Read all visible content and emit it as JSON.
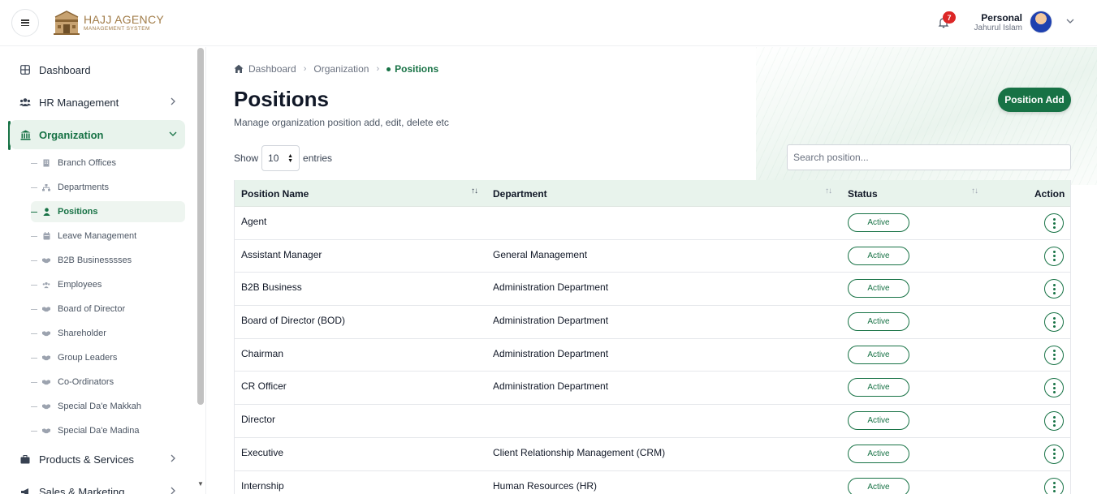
{
  "header": {
    "logo_title": "HAJJ AGENCY",
    "logo_subtitle": "MANAGEMENT SYSTEM",
    "notification_count": "7",
    "user_role": "Personal",
    "user_name": "Jahurul Islam"
  },
  "sidebar": {
    "items": [
      {
        "label": "Dashboard",
        "icon": "grid-icon"
      },
      {
        "label": "HR Management",
        "icon": "users-icon"
      },
      {
        "label": "Organization",
        "icon": "bank-icon",
        "expanded": true
      },
      {
        "label": "Products & Services",
        "icon": "briefcase-icon"
      },
      {
        "label": "Sales & Marketing",
        "icon": "megaphone-icon"
      }
    ],
    "sub_items": [
      {
        "label": "Branch Offices",
        "icon": "building-icon"
      },
      {
        "label": "Departments",
        "icon": "sitemap-icon"
      },
      {
        "label": "Positions",
        "icon": "user-icon",
        "active": true
      },
      {
        "label": "Leave Management",
        "icon": "calendar-icon"
      },
      {
        "label": "B2B Businesssses",
        "icon": "handshake-icon"
      },
      {
        "label": "Employees",
        "icon": "users-icon"
      },
      {
        "label": "Board of Director",
        "icon": "handshake-icon"
      },
      {
        "label": "Shareholder",
        "icon": "handshake-icon"
      },
      {
        "label": "Group Leaders",
        "icon": "handshake-icon"
      },
      {
        "label": "Co-Ordinators",
        "icon": "handshake-icon"
      },
      {
        "label": "Special Da'e Makkah",
        "icon": "handshake-icon"
      },
      {
        "label": "Special Da'e Madina",
        "icon": "handshake-icon"
      }
    ]
  },
  "breadcrumb": {
    "home": "Dashboard",
    "parent": "Organization",
    "current": "Positions"
  },
  "page": {
    "title": "Positions",
    "subtitle": "Manage organization position add, edit, delete etc",
    "add_button": "Position Add"
  },
  "table_controls": {
    "show_label": "Show",
    "entries_value": "10",
    "entries_label": "entries",
    "search_placeholder": "Search position..."
  },
  "table": {
    "columns": [
      "Position Name",
      "Department",
      "Status",
      "Action"
    ],
    "rows": [
      {
        "name": "Agent",
        "department": "",
        "status": "Active"
      },
      {
        "name": "Assistant Manager",
        "department": "General Management",
        "status": "Active"
      },
      {
        "name": "B2B Business",
        "department": "Administration Department",
        "status": "Active"
      },
      {
        "name": "Board of Director (BOD)",
        "department": "Administration Department",
        "status": "Active"
      },
      {
        "name": "Chairman",
        "department": "Administration Department",
        "status": "Active"
      },
      {
        "name": "CR Officer",
        "department": "Administration Department",
        "status": "Active"
      },
      {
        "name": "Director",
        "department": "",
        "status": "Active"
      },
      {
        "name": "Executive",
        "department": "Client Relationship Management (CRM)",
        "status": "Active"
      },
      {
        "name": "Internship",
        "department": "Human Resources (HR)",
        "status": "Active"
      }
    ]
  },
  "colors": {
    "brand_green": "#177245",
    "logo_gold": "#a17c48",
    "badge_red": "#dc2626"
  }
}
